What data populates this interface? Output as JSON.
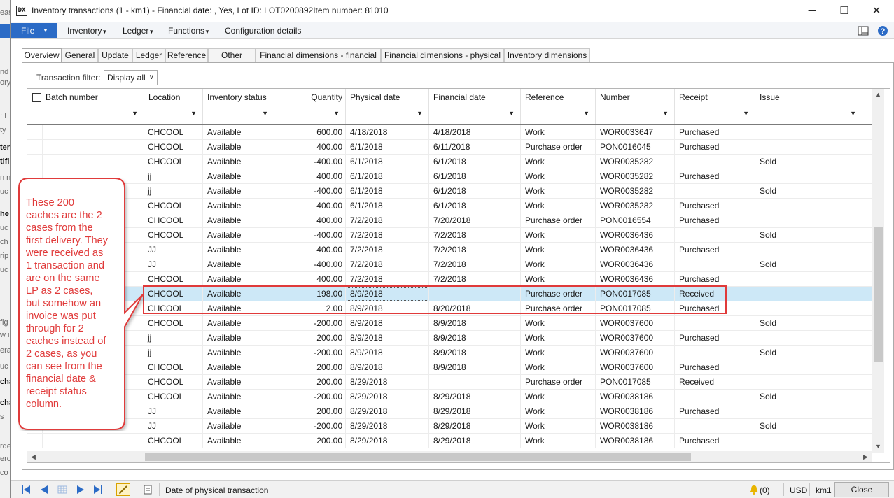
{
  "window": {
    "title": "Inventory transactions (1 - km1) - Financial date: , Yes, Lot ID: LOT0200892Item number: 81010",
    "icon_label": "DX",
    "minimize_icon": "minimize-icon",
    "maximize_icon": "maximize-icon",
    "close_icon": "close-icon"
  },
  "menu": {
    "file_label": "File",
    "items": [
      "Inventory",
      "Ledger",
      "Functions",
      "Configuration details"
    ]
  },
  "tabs": [
    "Overview",
    "General",
    "Update",
    "Ledger",
    "Reference",
    "Other",
    "Financial dimensions - financial",
    "Financial dimensions - physical",
    "Inventory dimensions"
  ],
  "filter": {
    "label": "Transaction filter:",
    "value": "Display all"
  },
  "grid": {
    "columns": [
      "Batch number",
      "Location",
      "Inventory status",
      "Quantity",
      "Physical date",
      "Financial date",
      "Reference",
      "Number",
      "Receipt",
      "Issue"
    ],
    "rows": [
      [
        "",
        "CHCOOL",
        "Available",
        "600.00",
        "4/18/2018",
        "4/18/2018",
        "Work",
        "WOR0033647",
        "Purchased",
        ""
      ],
      [
        "",
        "CHCOOL",
        "Available",
        "400.00",
        "6/1/2018",
        "6/11/2018",
        "Purchase order",
        "PON0016045",
        "Purchased",
        ""
      ],
      [
        "",
        "CHCOOL",
        "Available",
        "-400.00",
        "6/1/2018",
        "6/1/2018",
        "Work",
        "WOR0035282",
        "",
        "Sold"
      ],
      [
        "",
        "jj",
        "Available",
        "400.00",
        "6/1/2018",
        "6/1/2018",
        "Work",
        "WOR0035282",
        "Purchased",
        ""
      ],
      [
        "",
        "jj",
        "Available",
        "-400.00",
        "6/1/2018",
        "6/1/2018",
        "Work",
        "WOR0035282",
        "",
        "Sold"
      ],
      [
        "",
        "CHCOOL",
        "Available",
        "400.00",
        "6/1/2018",
        "6/1/2018",
        "Work",
        "WOR0035282",
        "Purchased",
        ""
      ],
      [
        "",
        "CHCOOL",
        "Available",
        "400.00",
        "7/2/2018",
        "7/20/2018",
        "Purchase order",
        "PON0016554",
        "Purchased",
        ""
      ],
      [
        "",
        "CHCOOL",
        "Available",
        "-400.00",
        "7/2/2018",
        "7/2/2018",
        "Work",
        "WOR0036436",
        "",
        "Sold"
      ],
      [
        "",
        "JJ",
        "Available",
        "400.00",
        "7/2/2018",
        "7/2/2018",
        "Work",
        "WOR0036436",
        "Purchased",
        ""
      ],
      [
        "",
        "JJ",
        "Available",
        "-400.00",
        "7/2/2018",
        "7/2/2018",
        "Work",
        "WOR0036436",
        "",
        "Sold"
      ],
      [
        "",
        "CHCOOL",
        "Available",
        "400.00",
        "7/2/2018",
        "7/2/2018",
        "Work",
        "WOR0036436",
        "Purchased",
        ""
      ],
      [
        "",
        "CHCOOL",
        "Available",
        "198.00",
        "8/9/2018",
        "",
        "Purchase order",
        "PON0017085",
        "Received",
        ""
      ],
      [
        "",
        "CHCOOL",
        "Available",
        "2.00",
        "8/9/2018",
        "8/20/2018",
        "Purchase order",
        "PON0017085",
        "Purchased",
        ""
      ],
      [
        "",
        "CHCOOL",
        "Available",
        "-200.00",
        "8/9/2018",
        "8/9/2018",
        "Work",
        "WOR0037600",
        "",
        "Sold"
      ],
      [
        "",
        "jj",
        "Available",
        "200.00",
        "8/9/2018",
        "8/9/2018",
        "Work",
        "WOR0037600",
        "Purchased",
        ""
      ],
      [
        "",
        "jj",
        "Available",
        "-200.00",
        "8/9/2018",
        "8/9/2018",
        "Work",
        "WOR0037600",
        "",
        "Sold"
      ],
      [
        "",
        "CHCOOL",
        "Available",
        "200.00",
        "8/9/2018",
        "8/9/2018",
        "Work",
        "WOR0037600",
        "Purchased",
        ""
      ],
      [
        "",
        "CHCOOL",
        "Available",
        "200.00",
        "8/29/2018",
        "",
        "Purchase order",
        "PON0017085",
        "Received",
        ""
      ],
      [
        "",
        "CHCOOL",
        "Available",
        "-200.00",
        "8/29/2018",
        "8/29/2018",
        "Work",
        "WOR0038186",
        "",
        "Sold"
      ],
      [
        "",
        "JJ",
        "Available",
        "200.00",
        "8/29/2018",
        "8/29/2018",
        "Work",
        "WOR0038186",
        "Purchased",
        ""
      ],
      [
        "",
        "JJ",
        "Available",
        "-200.00",
        "8/29/2018",
        "8/29/2018",
        "Work",
        "WOR0038186",
        "",
        "Sold"
      ],
      [
        "",
        "CHCOOL",
        "Available",
        "200.00",
        "8/29/2018",
        "8/29/2018",
        "Work",
        "WOR0038186",
        "Purchased",
        ""
      ]
    ],
    "selected_row": 11
  },
  "callout": {
    "lines": [
      "These 200",
      "eaches are the 2",
      "cases from the",
      "first delivery. They",
      "were received as",
      "1 transaction and",
      "are on the same",
      "LP as 2 cases,",
      "but somehow an",
      "invoice was put",
      "through for 2",
      "eaches instead of",
      "2 cases, as you",
      "can see from the",
      "financial date &",
      "receipt status",
      "column."
    ],
    "color": "#e03a3a"
  },
  "status": {
    "field_help": "Date of physical transaction",
    "notifications": "(0)",
    "currency": "USD",
    "company": "km1",
    "close_label": "Close"
  },
  "background": {
    "fragments": [
      "eas",
      "nd",
      "ory",
      ": I",
      "ty",
      "ter",
      "tifi",
      "n nu",
      "uc",
      "he",
      "uc",
      "ch",
      "rip",
      "uc",
      "fig",
      "w i",
      "era",
      "uc",
      "cha",
      "cha",
      "s",
      "rde",
      "ero",
      "co"
    ]
  },
  "colors": {
    "accent": "#2b6bc6",
    "selected_row": "#cde8f7",
    "highlight": "#e03a3a"
  }
}
